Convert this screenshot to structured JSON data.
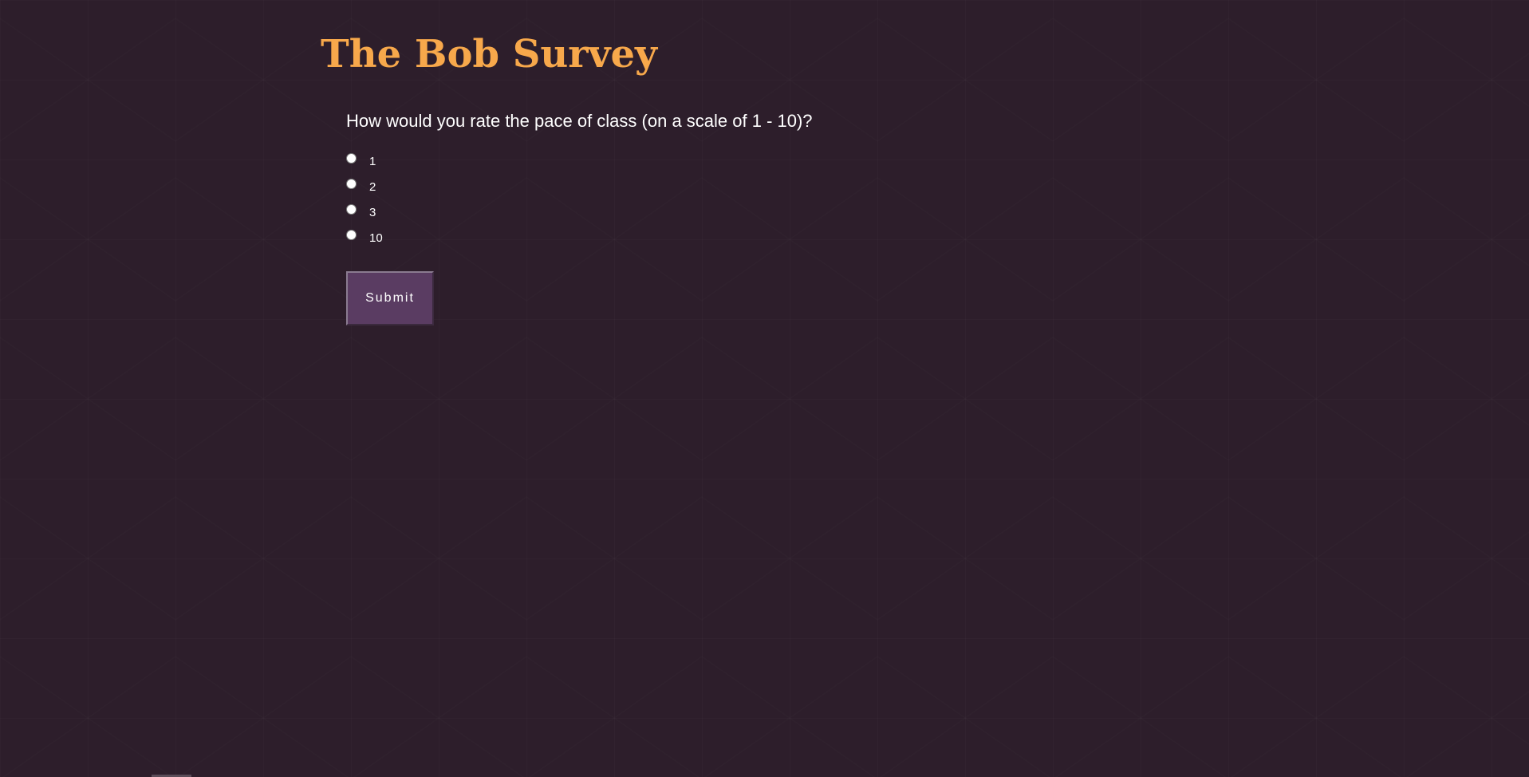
{
  "header": {
    "title": "The Bob Survey"
  },
  "survey": {
    "question": "How would you rate the pace of class (on a scale of 1 - 10)?",
    "options": [
      {
        "label": "1",
        "value": "1"
      },
      {
        "label": "2",
        "value": "2"
      },
      {
        "label": "3",
        "value": "3"
      },
      {
        "label": "10",
        "value": "10"
      }
    ],
    "selected": null,
    "submit_label": "Submit"
  },
  "colors": {
    "background": "#2d1e2b",
    "title": "#f7a84b",
    "text": "#ffffff",
    "button": "#5a3c62"
  }
}
